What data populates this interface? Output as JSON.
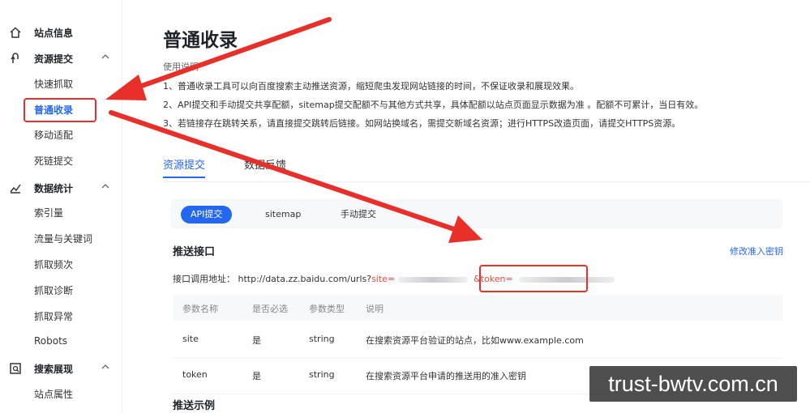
{
  "sidebar": {
    "sections": [
      {
        "label": "站点信息",
        "icon": "home-icon"
      },
      {
        "label": "资源提交",
        "icon": "submit-icon",
        "items": [
          "快速抓取",
          "普通收录",
          "移动适配",
          "死链提交"
        ]
      },
      {
        "label": "数据统计",
        "icon": "stats-icon",
        "items": [
          "索引量",
          "流量与关键词",
          "抓取频次",
          "抓取诊断",
          "抓取异常",
          "Robots"
        ]
      },
      {
        "label": "搜索展现",
        "icon": "search-display-icon",
        "items": [
          "站点属性"
        ]
      }
    ],
    "active_item": "普通收录"
  },
  "main": {
    "title": "普通收录",
    "usage_heading": "使用说明",
    "usage_lines": [
      "1、普通收录工具可以向百度搜索主动推送资源，缩短爬虫发现网站链接的时间，不保证收录和展现效果。",
      "2、API提交和手动提交共享配额，sitemap提交配额不与其他方式共享，具体配额以站点页面显示数据为准 。配额不可累计，当日有效。",
      "3、若链接存在跳转关系，请直接提交跳转后链接。如网站换域名，需提交新域名资源；进行HTTPS改造页面，请提交HTTPS资源。"
    ],
    "tabs": [
      {
        "label": "资源提交",
        "active": true
      },
      {
        "label": "数据反馈",
        "active": false
      }
    ],
    "subtabs": [
      {
        "label": "API提交",
        "active": true
      },
      {
        "label": "sitemap",
        "active": false
      },
      {
        "label": "手动提交",
        "active": false
      }
    ],
    "section_title": "推送接口",
    "modify_link": "修改准入密钥",
    "api": {
      "label": "接口调用地址：",
      "url": "http://data.zz.baidu.com/urls?",
      "site_param": "site=",
      "token_param": "&token="
    },
    "table": {
      "headers": [
        "参数名称",
        "是否必选",
        "参数类型",
        "说明"
      ],
      "rows": [
        [
          "site",
          "是",
          "string",
          "在搜索资源平台验证的站点，比如www.example.com"
        ],
        [
          "token",
          "是",
          "string",
          "在搜索资源平台申请的推送用的准入密钥"
        ]
      ]
    },
    "example_title": "推送示例"
  },
  "watermark": "trust-bwtv.com.cn",
  "colors": {
    "accent": "#2468f2",
    "highlight_red": "#e8302b",
    "param_red": "#e04b3a"
  }
}
